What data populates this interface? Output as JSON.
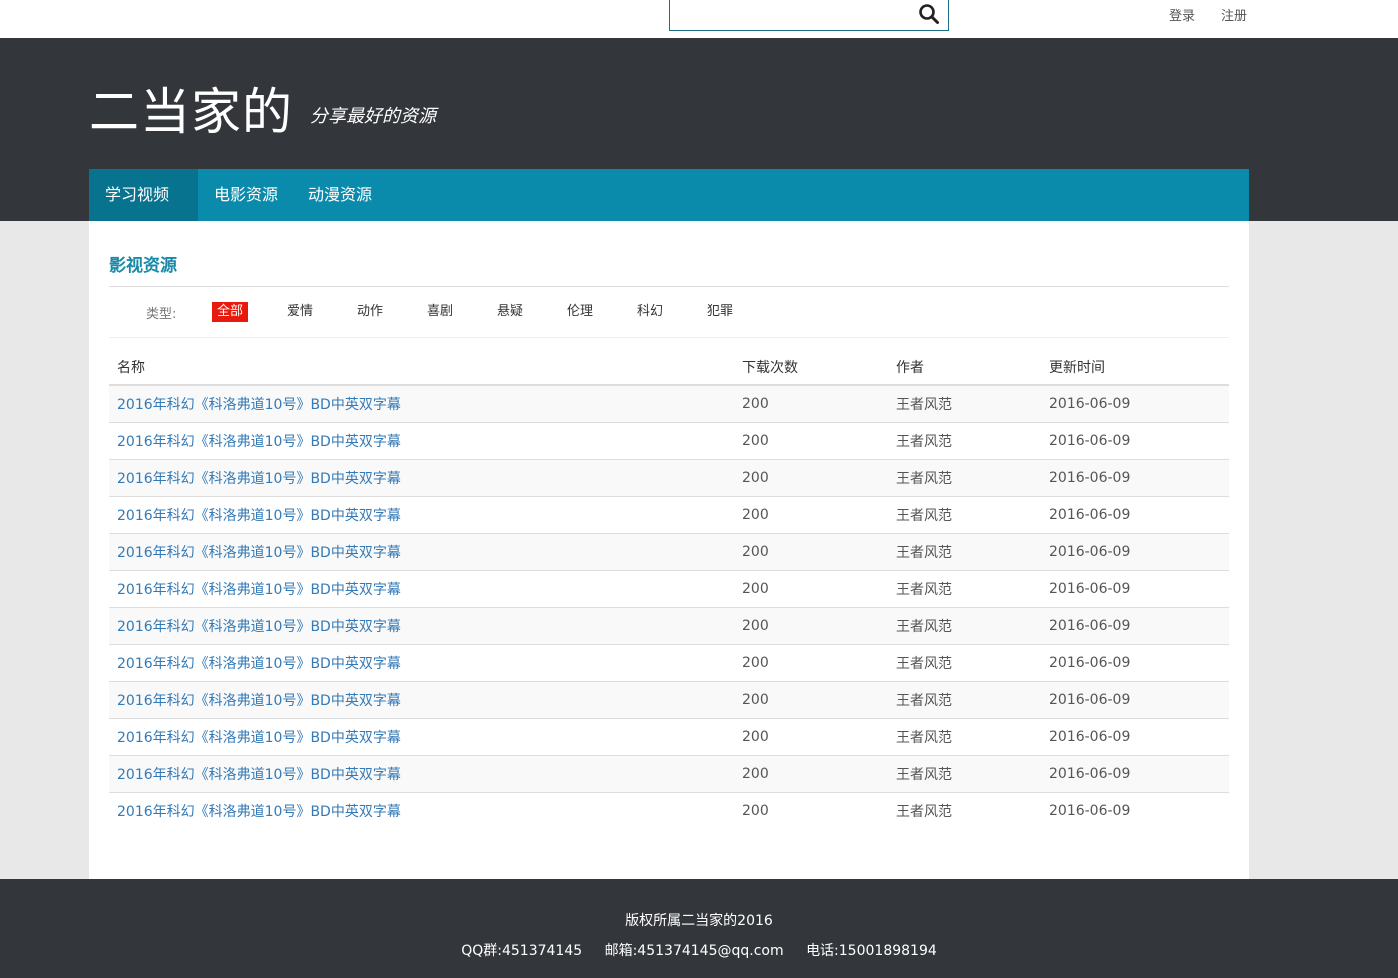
{
  "topbar": {
    "search": {
      "value": "",
      "placeholder": ""
    },
    "login": "登录",
    "register": "注册"
  },
  "header": {
    "brand": "二当家的",
    "tagline": "分享最好的资源"
  },
  "nav": {
    "items": [
      {
        "label": "学习视频",
        "active": true,
        "dropdown": true
      },
      {
        "label": "电影资源",
        "active": false
      },
      {
        "label": "动漫资源",
        "active": false
      }
    ]
  },
  "main": {
    "title": "影视资源",
    "filter": {
      "label": "类型:",
      "items": [
        "全部",
        "爱情",
        "动作",
        "喜剧",
        "悬疑",
        "伦理",
        "科幻",
        "犯罪"
      ],
      "active_index": 0
    },
    "table": {
      "headers": [
        "名称",
        "下载次数",
        "作者",
        "更新时间"
      ],
      "rows": [
        [
          "2016年科幻《科洛弗道10号》BD中英双字幕",
          "200",
          "王者风范",
          "2016-06-09"
        ],
        [
          "2016年科幻《科洛弗道10号》BD中英双字幕",
          "200",
          "王者风范",
          "2016-06-09"
        ],
        [
          "2016年科幻《科洛弗道10号》BD中英双字幕",
          "200",
          "王者风范",
          "2016-06-09"
        ],
        [
          "2016年科幻《科洛弗道10号》BD中英双字幕",
          "200",
          "王者风范",
          "2016-06-09"
        ],
        [
          "2016年科幻《科洛弗道10号》BD中英双字幕",
          "200",
          "王者风范",
          "2016-06-09"
        ],
        [
          "2016年科幻《科洛弗道10号》BD中英双字幕",
          "200",
          "王者风范",
          "2016-06-09"
        ],
        [
          "2016年科幻《科洛弗道10号》BD中英双字幕",
          "200",
          "王者风范",
          "2016-06-09"
        ],
        [
          "2016年科幻《科洛弗道10号》BD中英双字幕",
          "200",
          "王者风范",
          "2016-06-09"
        ],
        [
          "2016年科幻《科洛弗道10号》BD中英双字幕",
          "200",
          "王者风范",
          "2016-06-09"
        ],
        [
          "2016年科幻《科洛弗道10号》BD中英双字幕",
          "200",
          "王者风范",
          "2016-06-09"
        ],
        [
          "2016年科幻《科洛弗道10号》BD中英双字幕",
          "200",
          "王者风范",
          "2016-06-09"
        ],
        [
          "2016年科幻《科洛弗道10号》BD中英双字幕",
          "200",
          "王者风范",
          "2016-06-09"
        ]
      ]
    }
  },
  "footer": {
    "copyright": "版权所属二当家的2016",
    "qq": "QQ群:451374145",
    "email": "邮箱:451374145@qq.com",
    "phone": "电话:15001898194"
  },
  "colors": {
    "header_bg": "#33363b",
    "nav_bg": "#0b8bab",
    "nav_active_bg": "#08738f",
    "accent_title": "#1a8aa8",
    "filter_active": "#e8190d",
    "link": "#337ab7"
  },
  "icons": {
    "search": "search-icon"
  }
}
